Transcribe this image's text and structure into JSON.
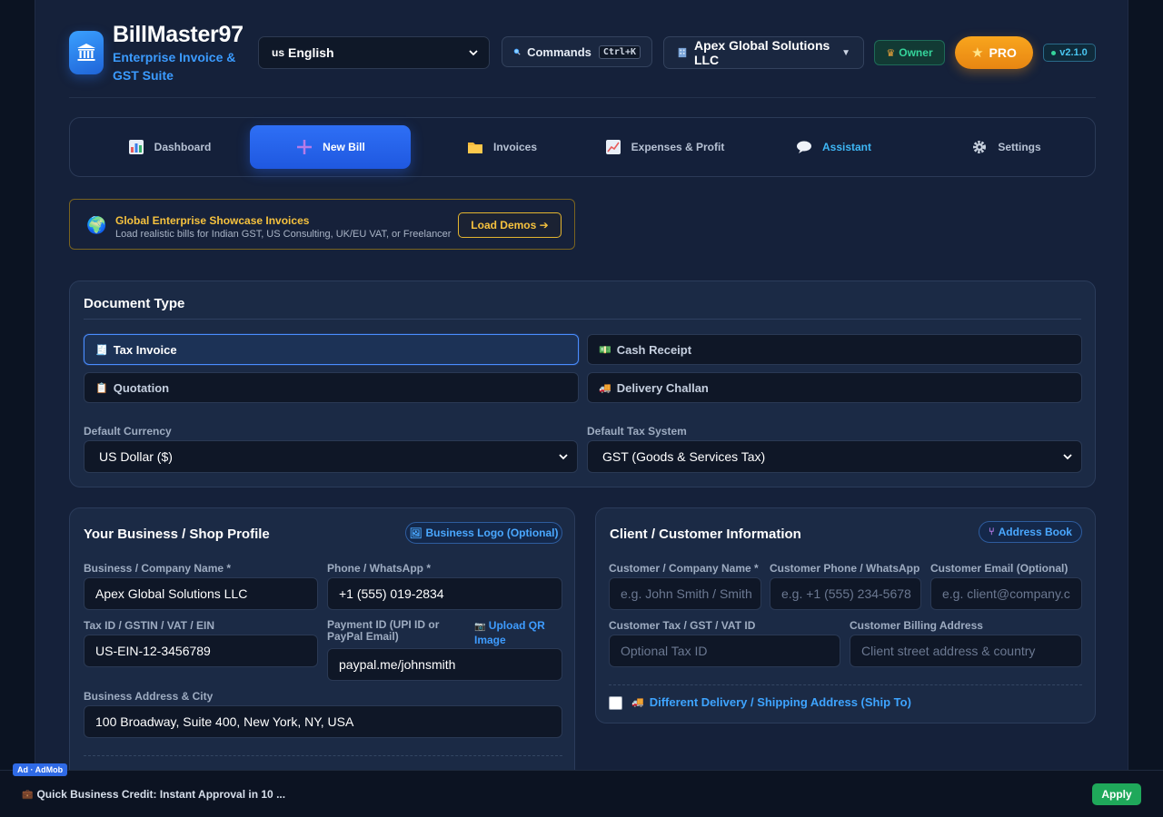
{
  "brand": {
    "title": "BillMaster97",
    "subtitle": "Enterprise Invoice & GST Suite",
    "logo_icon": "bank-icon"
  },
  "header": {
    "language": {
      "flag": "us",
      "label": "English"
    },
    "commands": {
      "label": "Commands",
      "shortcut": "Ctrl+K"
    },
    "organization": "Apex Global Solutions LLC",
    "role_badge": "Owner",
    "pro_label": "PRO",
    "version": "v2.1.0"
  },
  "nav": {
    "items": [
      {
        "label": "Dashboard",
        "icon": "bar-chart-icon"
      },
      {
        "label": "New Bill",
        "icon": "plus-icon",
        "active": true
      },
      {
        "label": "Invoices",
        "icon": "folder-icon"
      },
      {
        "label": "Expenses & Profit",
        "icon": "line-chart-icon"
      },
      {
        "label": "Assistant",
        "icon": "speech-bubble-icon"
      },
      {
        "label": "Settings",
        "icon": "gear-icon"
      }
    ]
  },
  "showcase": {
    "title": "Global Enterprise Showcase Invoices",
    "description": "Load realistic bills for Indian GST, US Consulting, UK/EU VAT, or Freelancer",
    "button": "Load Demos ➔"
  },
  "document_type": {
    "title": "Document Type",
    "options": [
      {
        "label": "Tax Invoice",
        "icon": "receipt-icon",
        "selected": true
      },
      {
        "label": "Cash Receipt",
        "icon": "cash-icon"
      },
      {
        "label": "Quotation",
        "icon": "clipboard-icon"
      },
      {
        "label": "Delivery Challan",
        "icon": "truck-icon"
      }
    ],
    "currency_label": "Default Currency",
    "currency_value": "US Dollar ($)",
    "tax_label": "Default Tax System",
    "tax_value": "GST (Goods & Services Tax)"
  },
  "business": {
    "title": "Your Business / Shop Profile",
    "logo_button": "Business Logo (Optional)",
    "name_label": "Business / Company Name *",
    "name_value": "Apex Global Solutions LLC",
    "phone_label": "Phone / WhatsApp *",
    "phone_value": "+1 (555) 019-2834",
    "tax_label": "Tax ID / GSTIN / VAT / EIN",
    "tax_value": "US-EIN-12-3456789",
    "payment_label": "Payment ID (UPI ID or PayPal Email)",
    "upload_qr": "Upload QR Image",
    "payment_value": "paypal.me/johnsmith",
    "address_label": "Business Address & City",
    "address_value": "100 Broadway, Suite 400, New York, NY, USA"
  },
  "client": {
    "title": "Client / Customer Information",
    "address_book": "Address Book",
    "name_label": "Customer / Company Name *",
    "name_placeholder": "e.g. John Smith / Smith",
    "phone_label": "Customer Phone / WhatsApp",
    "phone_placeholder": "e.g. +1 (555) 234-5678",
    "email_label": "Customer Email (Optional)",
    "email_placeholder": "e.g. client@company.c",
    "tax_label": "Customer Tax / GST / VAT ID",
    "tax_placeholder": "Optional Tax ID",
    "address_label": "Customer Billing Address",
    "address_placeholder": "Client street address & country",
    "ship_label": "Different Delivery / Shipping Address (Ship To)"
  },
  "ad": {
    "tag": "Ad · AdMob",
    "text": "Quick Business Credit: Instant Approval in 10 ...",
    "button": "Apply"
  }
}
